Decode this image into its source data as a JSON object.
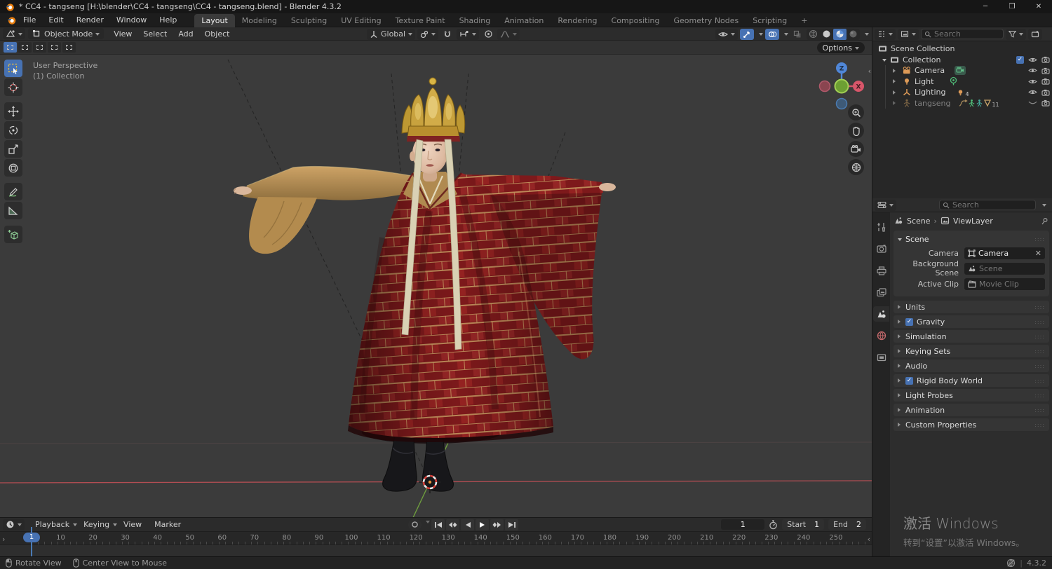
{
  "window": {
    "title": "* CC4 - tangseng [H:\\blender\\CC4 - tangseng\\CC4 - tangseng.blend] - Blender 4.3.2"
  },
  "topbar": {
    "menus": [
      "File",
      "Edit",
      "Render",
      "Window",
      "Help"
    ],
    "workspaces": [
      "Layout",
      "Modeling",
      "Sculpting",
      "UV Editing",
      "Texture Paint",
      "Shading",
      "Animation",
      "Rendering",
      "Compositing",
      "Geometry Nodes",
      "Scripting"
    ],
    "add_workspace": "+",
    "scene": "Scene",
    "viewlayer": "ViewLayer"
  },
  "viewport": {
    "mode": "Object Mode",
    "menus": [
      "View",
      "Select",
      "Add",
      "Object"
    ],
    "orientation": "Global",
    "options": "Options",
    "overlay": {
      "title": "User Perspective",
      "subtitle": "(1) Collection"
    }
  },
  "outliner": {
    "search_placeholder": "Search",
    "rows": [
      {
        "label": "Scene Collection"
      },
      {
        "label": "Collection"
      },
      {
        "label": "Camera"
      },
      {
        "label": "Light"
      },
      {
        "label": "Lighting",
        "badge_count": "4"
      },
      {
        "label": "tangseng",
        "badge_count": "11"
      }
    ]
  },
  "properties": {
    "search_placeholder": "Search",
    "breadcrumb": {
      "scene": "Scene",
      "viewlayer": "ViewLayer"
    },
    "scene_panel": {
      "title": "Scene",
      "camera_label": "Camera",
      "camera_value": "Camera",
      "background_label": "Background Scene",
      "background_placeholder": "Scene",
      "clip_label": "Active Clip",
      "clip_placeholder": "Movie Clip"
    },
    "panels": [
      {
        "label": "Units",
        "checked": false
      },
      {
        "label": "Gravity",
        "checked": true
      },
      {
        "label": "Simulation",
        "checked": false
      },
      {
        "label": "Keying Sets",
        "checked": false
      },
      {
        "label": "Audio",
        "checked": false
      },
      {
        "label": "Rigid Body World",
        "checked": true
      },
      {
        "label": "Light Probes",
        "checked": false
      },
      {
        "label": "Animation",
        "checked": false
      },
      {
        "label": "Custom Properties",
        "checked": false
      }
    ]
  },
  "timeline": {
    "menus": [
      "Playback",
      "Keying",
      "View",
      "Marker"
    ],
    "current_frame": "1",
    "start_label": "Start",
    "start_value": "1",
    "end_label": "End",
    "end_value": "2",
    "ticks": [
      10,
      20,
      30,
      40,
      50,
      60,
      70,
      80,
      90,
      100,
      110,
      120,
      130,
      140,
      150,
      160,
      170,
      180,
      190,
      200,
      210,
      220,
      230,
      240,
      250
    ]
  },
  "statusbar": {
    "hints": [
      "Rotate View",
      "Center View to Mouse"
    ],
    "version": "4.3.2"
  },
  "watermark": {
    "line1": "激活 Windows",
    "line2": "转到“设置”以激活 Windows。"
  }
}
